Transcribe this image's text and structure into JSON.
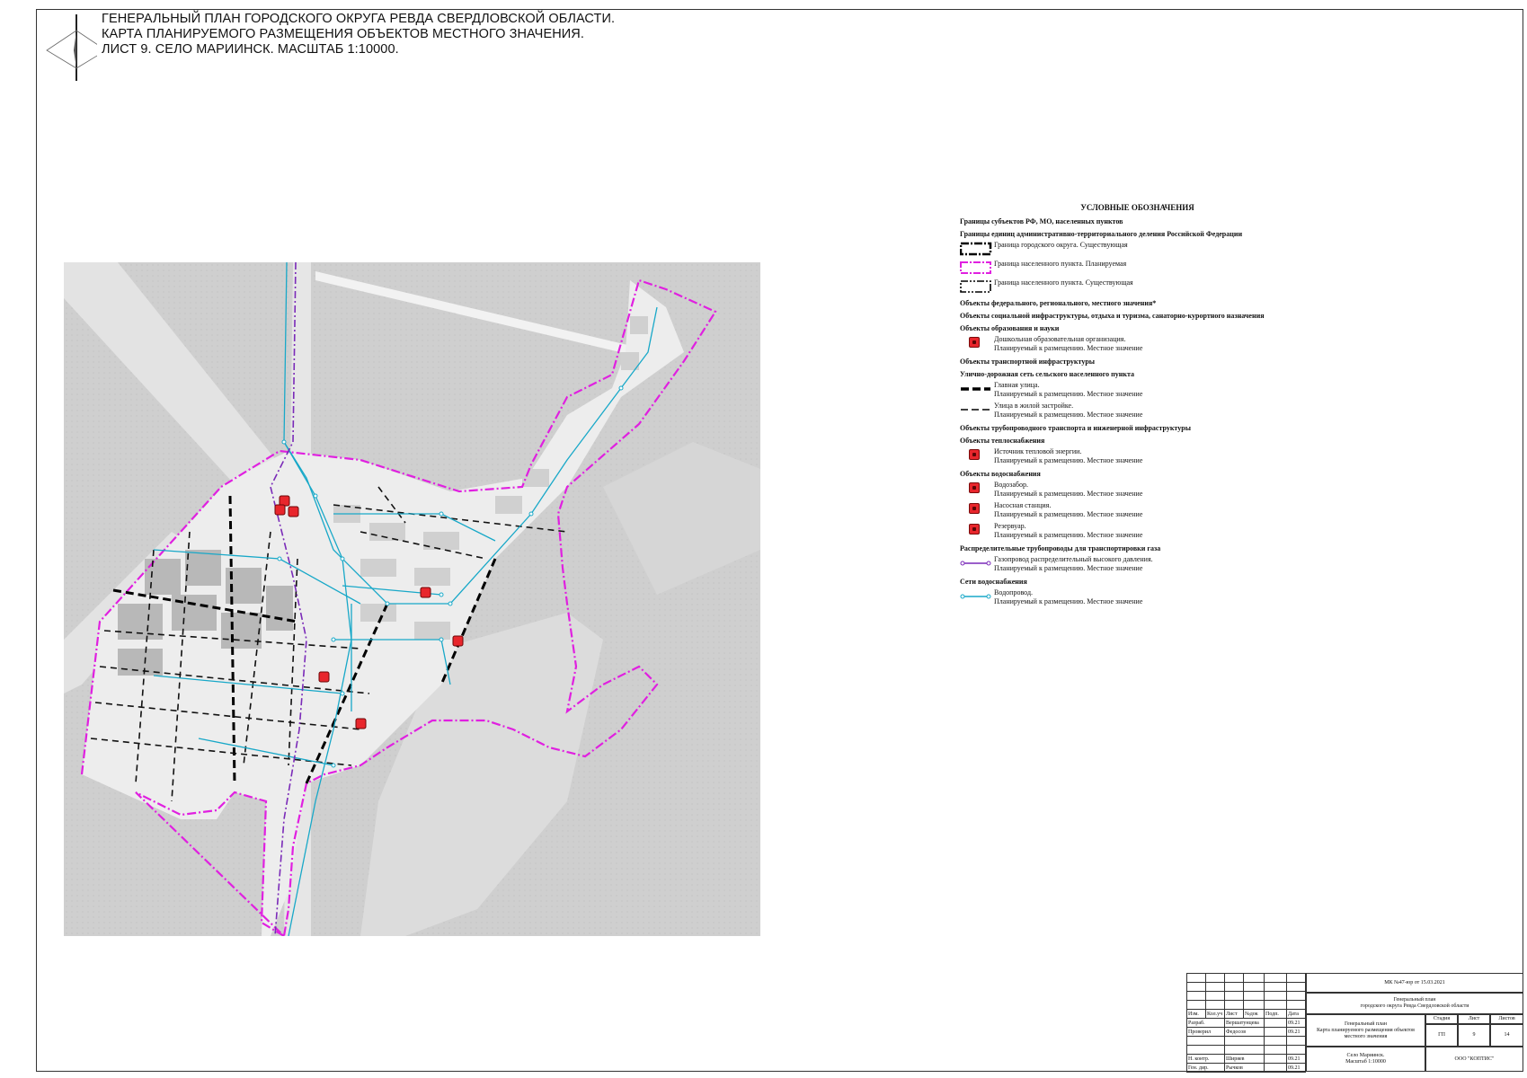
{
  "title": {
    "line1": "ГЕНЕРАЛЬНЫЙ ПЛАН ГОРОДСКОГО ОКРУГА РЕВДА СВЕРДЛОВСКОЙ ОБЛАСТИ.",
    "line2": "КАРТА ПЛАНИРУЕМОГО РАЗМЕЩЕНИЯ ОБЪЕКТОВ МЕСТНОГО ЗНАЧЕНИЯ.",
    "line3": "ЛИСТ 9. СЕЛО МАРИИНСК. МАСШТАБ 1:10000."
  },
  "colors": {
    "map_background": "#cfcfcf",
    "settlement_fill": "#ededed",
    "planned_boundary": "#e020e0",
    "water_pipe": "#18a8c8",
    "gas_pipe": "#7a2ab8",
    "facility_red": "#e8262c"
  },
  "legend": {
    "title": "УСЛОВНЫЕ ОБОЗНАЧЕНИЯ",
    "h_boundaries": "Границы субъектов РФ, МО, населенных пунктов",
    "h_admin": "Границы единиц административно-территориального деления Российской Федерации",
    "boundary_city": "Граница городского округа. Существующая",
    "boundary_planned": "Граница населенного пункта. Планируемая",
    "boundary_existing": "Граница населенного пункта. Существующая",
    "h_objects": "Объекты федерального, регионального, местного значения*",
    "h_social": "Объекты социальной инфраструктуры, отдыха и туризма, санаторно-курортного назначения",
    "h_education": "Объекты образования и науки",
    "preschool_1": "Дошкольная образовательная организация.",
    "preschool_2": "Планируемый к размещению. Местное значение",
    "h_transport": "Объекты транспортной инфраструктуры",
    "h_streets": "Улично-дорожная сеть сельского населенного пункта",
    "main_street_1": "Главная улица.",
    "main_street_2": "Планируемый к размещению. Местное значение",
    "res_street_1": "Улица в жилой застройке.",
    "res_street_2": "Планируемый к размещению. Местное значение",
    "h_pipeline": "Объекты трубопроводного транспорта и инженерной инфраструктуры",
    "h_heat": "Объекты теплоснабжения",
    "heat_1": "Источник тепловой энергии.",
    "heat_2": "Планируемый к размещению. Местное значение",
    "h_water": "Объекты водоснабжения",
    "intake_1": "Водозабор.",
    "intake_2": "Планируемый к размещению. Местное значение",
    "pump_1": "Насосная станция.",
    "pump_2": "Планируемый к размещению. Местное значение",
    "reservoir_1": "Резервуар.",
    "reservoir_2": "Планируемый к размещению. Местное значение",
    "h_gas": "Распределительные трубопроводы для транспортировки газа",
    "gas_1": "Газопровод распределительный высокого давления.",
    "gas_2": "Планируемый к размещению. Местное значение",
    "h_waternet": "Сети водоснабжения",
    "waterpipe_1": "Водопровод.",
    "waterpipe_2": "Планируемый к размещению. Местное значение"
  },
  "stamp": {
    "contract": "МК №47-юр от 15.03.2021",
    "project_1": "Генеральный план",
    "project_2": "городского округа Ревда Свердловской области",
    "h_izm": "Изм.",
    "h_kol": "Кол.уч",
    "h_list": "Лист",
    "h_ndok": "№док",
    "h_podp": "Подп.",
    "h_data": "Дата",
    "r1_role": "Разраб.",
    "r1_name": "Вершатунцева",
    "r1_date": "09.21",
    "r2_role": "Проверил",
    "r2_name": "Федосов",
    "r2_date": "09.21",
    "r3_role": "Н. контр.",
    "r3_name": "Ширяев",
    "r3_date": "09.21",
    "r4_role": "Ген. дир.",
    "r4_name": "Рычков",
    "r4_date": "09.21",
    "sheet_name_1": "Генеральный план",
    "sheet_name_2": "Карта планируемого размещения объектов",
    "sheet_name_3": "местного значения",
    "h_stage": "Стадия",
    "h_sheet": "Лист",
    "h_sheets": "Листов",
    "stage": "ГП",
    "sheet": "9",
    "sheets": "14",
    "place_1": "Село Мариинск.",
    "place_2": "Масштаб 1:10000",
    "company": "ООО \"КОПТИС\""
  }
}
